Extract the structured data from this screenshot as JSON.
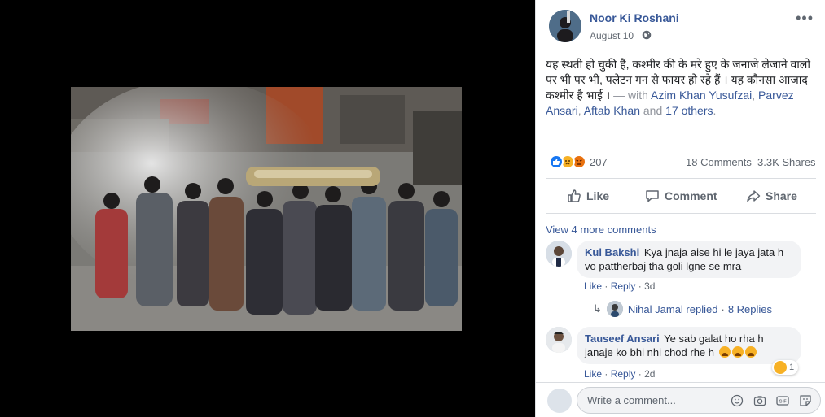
{
  "post": {
    "author": "Noor Ki Roshani",
    "date": "August 10",
    "text_main": "यह स्थती हो चुकी हैं, कश्मीर की के मरे हुए के जनाजे लेजाने वालो पर भी पर भी, पलेटन गन से फायर हो रहे हैं । यह कौनसा आजाद कश्मीर है भाई ।",
    "with_prefix": " — with ",
    "tag1": "Azim Khan Yusufzai",
    "sep1": ", ",
    "tag2": "Parvez Ansari",
    "sep2": ", ",
    "tag3": "Aftab Khan",
    "and_text": " and ",
    "others": "17 others",
    "period": "."
  },
  "stats": {
    "reactions": "207",
    "comments": "18 Comments",
    "shares": "3.3K Shares"
  },
  "actions": {
    "like": "Like",
    "comment": "Comment",
    "share": "Share"
  },
  "comments": {
    "view_more": "View 4 more comments",
    "c1": {
      "name": "Kul Bakshi",
      "text": "Kya jnaja aise hi le jaya jata h vo pattherbaj tha goli lgne se mra",
      "like": "Like",
      "reply": "Reply",
      "time": "3d",
      "replied": "Nihal Jamal replied",
      "dot": "·",
      "replies": "8 Replies"
    },
    "c2": {
      "name": "Tauseef Ansari",
      "text": "Ye sab galat ho rha h janaje ko bhi nhi chod rhe h",
      "like": "Like",
      "reply": "Reply",
      "time": "2d",
      "reaction_count": "1"
    },
    "dot": "·"
  },
  "composer": {
    "placeholder": "Write a comment..."
  },
  "colors": {
    "link": "#385898",
    "muted": "#606770",
    "like_blue": "#1877f2",
    "sad_yellow": "#f7b125"
  },
  "icons": [
    "more-icon",
    "globe-icon",
    "like-icon",
    "comment-icon",
    "share-icon",
    "smile-icon",
    "camera-icon",
    "gif-icon",
    "sticker-icon"
  ]
}
